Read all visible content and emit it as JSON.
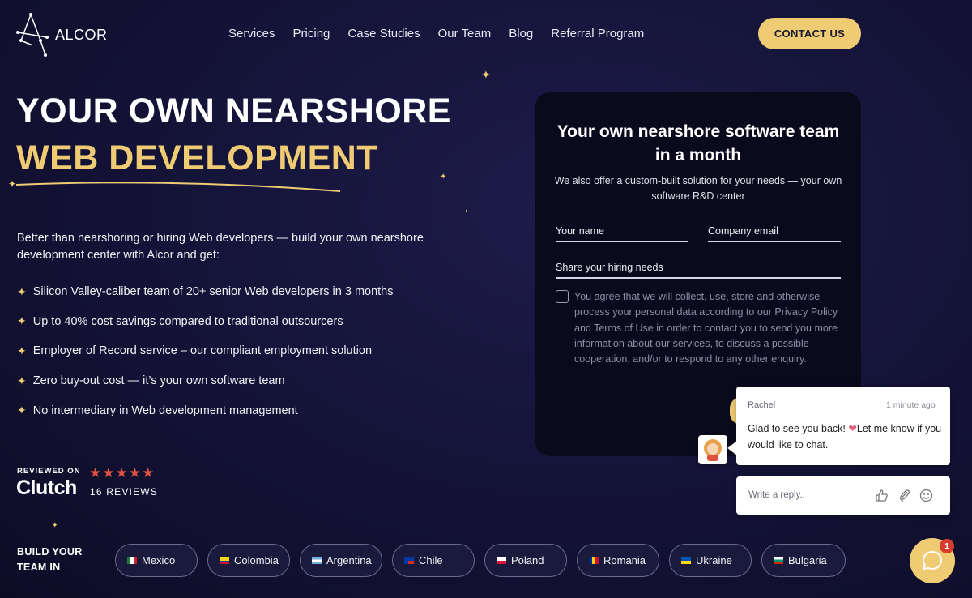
{
  "header": {
    "logo_text": "ALCOR",
    "nav": [
      "Services",
      "Pricing",
      "Case Studies",
      "Our Team",
      "Blog",
      "Referral Program"
    ],
    "contact_label": "CONTACT US"
  },
  "hero": {
    "line1": "YOUR OWN NEARSHORE",
    "line2": "WEB DEVELOPMENT",
    "intro": "Better than nearshoring or hiring Web developers — build your own nearshore development center with Alcor and get:",
    "benefits": [
      "Silicon Valley-caliber team of 20+ senior Web developers in 3 months",
      "Up to 40% cost savings compared to traditional outsourcers",
      "Employer of Record service – our compliant employment solution",
      "Zero buy-out cost — it’s your own software team",
      "No intermediary in Web development management"
    ]
  },
  "clutch": {
    "reviewed_on": "REVIEWED ON",
    "brand": "Clutch",
    "stars": "★★★★★",
    "reviews": "16 REVIEWS"
  },
  "build": {
    "label_line1": "BUILD YOUR",
    "label_line2": "TEAM IN",
    "countries": [
      "Mexico",
      "Colombia",
      "Argentina",
      "Chile",
      "Poland",
      "Romania",
      "Ukraine",
      "Bulgaria"
    ]
  },
  "form": {
    "title_line1": "Your own nearshore software team",
    "title_line2": "in a month",
    "subtitle": "We also offer a custom-built solution for your needs — your own software R&D center",
    "name_placeholder": "Your name",
    "email_placeholder": "Company email",
    "needs_placeholder": "Share your hiring needs",
    "consent": "You agree that we will collect, use, store and otherwise process your personal data according to our Privacy Policy and Terms of Use in order to contact you to send you more information about our services, to discuss a possible cooperation, and/or to respond to any other enquiry."
  },
  "chat": {
    "agent_name": "Rachel",
    "time": "1 minute ago",
    "message_before": "Glad to see you back! ",
    "message_heart": "❤",
    "message_after": "Let me know if you would like to chat.",
    "reply_placeholder": "Write a reply..",
    "badge_count": "1"
  },
  "colors": {
    "accent_gold": "#efcb74",
    "background": "#15143a",
    "card": "#0a0a1c",
    "star_red": "#e0523f"
  }
}
